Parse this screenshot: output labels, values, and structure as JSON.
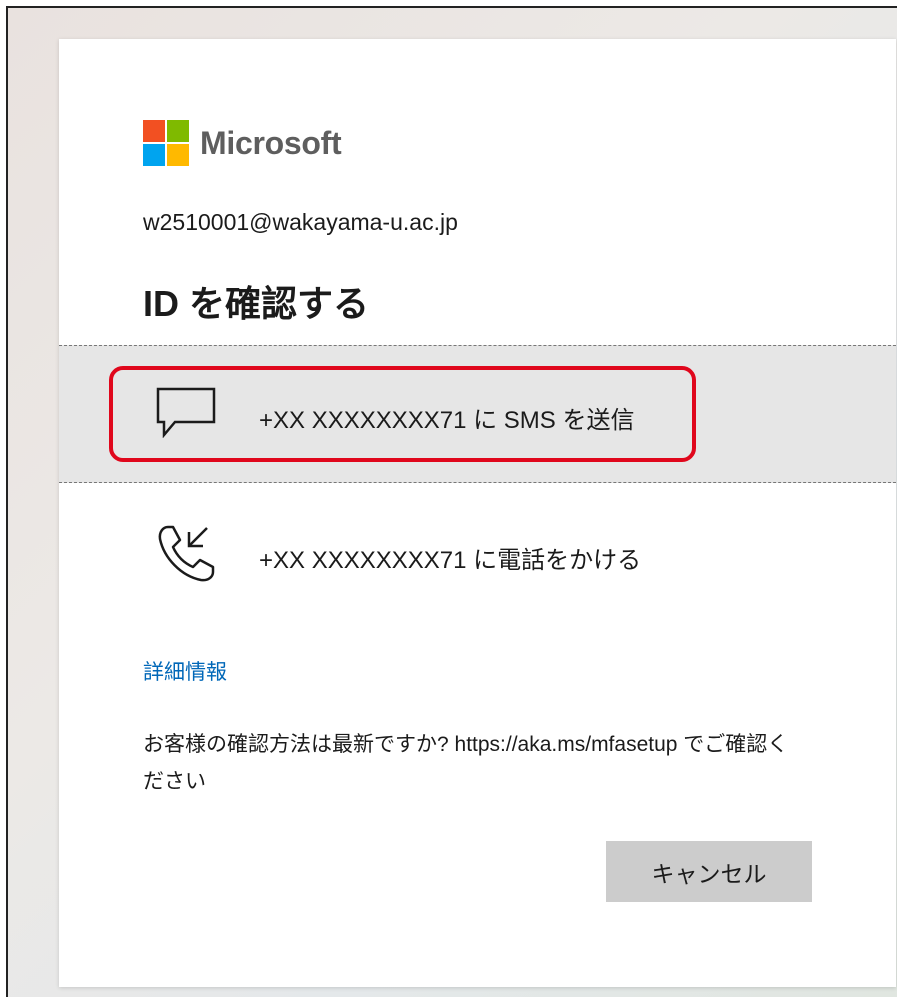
{
  "brand": {
    "name": "Microsoft",
    "logo_colors": [
      "#f25022",
      "#7fba00",
      "#00a4ef",
      "#ffb900"
    ]
  },
  "account": "w2510001@wakayama-u.ac.jp",
  "title": "ID を確認する",
  "options": [
    {
      "label": "+XX XXXXXXXX71 に SMS を送信",
      "icon": "chat-bubble-icon",
      "selected": true
    },
    {
      "label": "+XX XXXXXXXX71 に電話をかける",
      "icon": "phone-call-icon",
      "selected": false
    }
  ],
  "more_info_link": "詳細情報",
  "info_text": "お客様の確認方法は最新ですか? https://aka.ms/mfasetup でご確認ください",
  "cancel_label": "キャンセル",
  "colors": {
    "highlight": "#e0071c",
    "link": "#0067b8",
    "button_bg": "#cccccc",
    "selected_bg": "#e6e6e6"
  }
}
